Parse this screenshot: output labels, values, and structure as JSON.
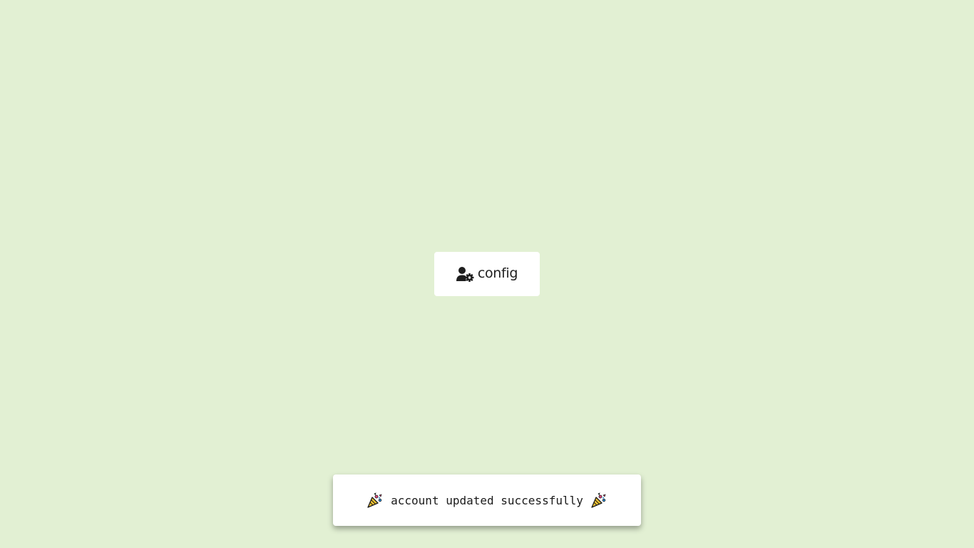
{
  "colors": {
    "background": "#e2f0d3",
    "card": "#ffffff",
    "text": "#1f1f1f"
  },
  "config_button": {
    "icon": "user-gear-icon",
    "label": "config"
  },
  "toast": {
    "leading_icon": "party-popper-icon",
    "message": "account updated successfully",
    "trailing_icon": "party-popper-icon"
  }
}
